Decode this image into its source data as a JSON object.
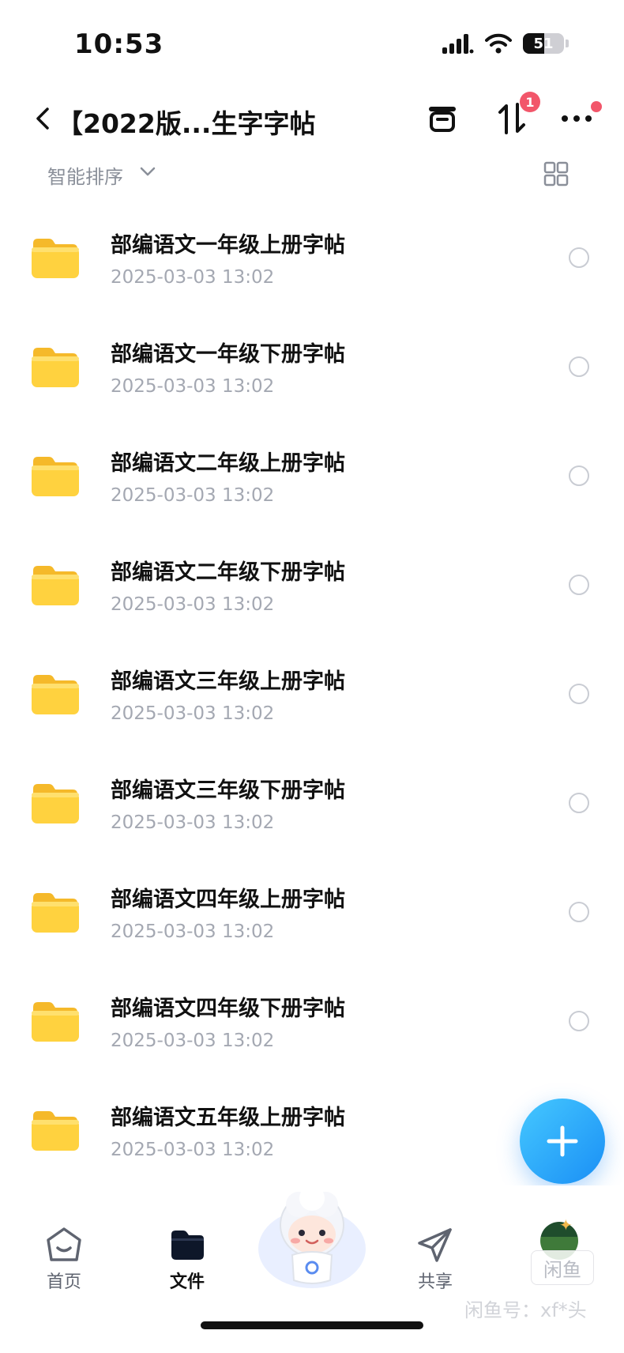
{
  "status_bar": {
    "time": "10:53",
    "battery": "51"
  },
  "header": {
    "title": "【2022版...生字字帖",
    "transfer_badge": "1"
  },
  "sort": {
    "label": "智能排序"
  },
  "files": [
    {
      "name": "部编语文一年级上册字帖",
      "date": "2025-03-03 13:02"
    },
    {
      "name": "部编语文一年级下册字帖",
      "date": "2025-03-03 13:02"
    },
    {
      "name": "部编语文二年级上册字帖",
      "date": "2025-03-03 13:02"
    },
    {
      "name": "部编语文二年级下册字帖",
      "date": "2025-03-03 13:02"
    },
    {
      "name": "部编语文三年级上册字帖",
      "date": "2025-03-03 13:02"
    },
    {
      "name": "部编语文三年级下册字帖",
      "date": "2025-03-03 13:02"
    },
    {
      "name": "部编语文四年级上册字帖",
      "date": "2025-03-03 13:02"
    },
    {
      "name": "部编语文四年级下册字帖",
      "date": "2025-03-03 13:02"
    },
    {
      "name": "部编语文五年级上册字帖",
      "date": "2025-03-03 13:02"
    }
  ],
  "bottom_nav": {
    "home": "首页",
    "files": "文件",
    "share": "共享"
  },
  "watermark": {
    "box": "闲鱼",
    "text": "闲鱼号：xf*头"
  },
  "colors": {
    "accent": "#1a8ff5",
    "badge": "#f2566a",
    "folder": "#ffd23f",
    "muted_text": "#a4a8b2"
  }
}
